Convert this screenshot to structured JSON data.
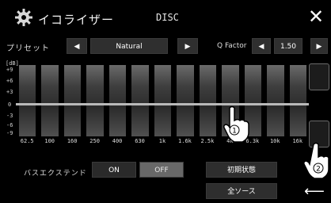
{
  "header": {
    "title": "イコライザー",
    "source": "DISC",
    "close_label": "✕"
  },
  "preset": {
    "label": "プリセット",
    "value": "Natural",
    "prev_symbol": "◀",
    "next_symbol": "▶"
  },
  "q_factor": {
    "label": "Q Factor",
    "value": "1.50",
    "prev_symbol": "◀",
    "next_symbol": "▶"
  },
  "graph": {
    "db_unit": "[dB]",
    "db_labels": [
      "+9",
      "+6",
      "+3",
      "0",
      "-3",
      "-6",
      "-9"
    ],
    "frequencies": [
      "62.5",
      "100",
      "160",
      "250",
      "400",
      "630",
      "1k",
      "1.6k",
      "2.5k",
      "4k",
      "6.3k",
      "10k",
      "16k"
    ],
    "band_levels_db": [
      0,
      0,
      0,
      0,
      0,
      0,
      0,
      0,
      0,
      0,
      0,
      0,
      0
    ]
  },
  "bass_extend": {
    "label": "バスエクステンド",
    "on_label": "ON",
    "off_label": "OFF",
    "selected": "OFF"
  },
  "buttons": {
    "reset": "初期状態",
    "all_sources": "全ソース",
    "back": "⟵"
  },
  "annotations": {
    "step1": "1",
    "step2": "2"
  }
}
